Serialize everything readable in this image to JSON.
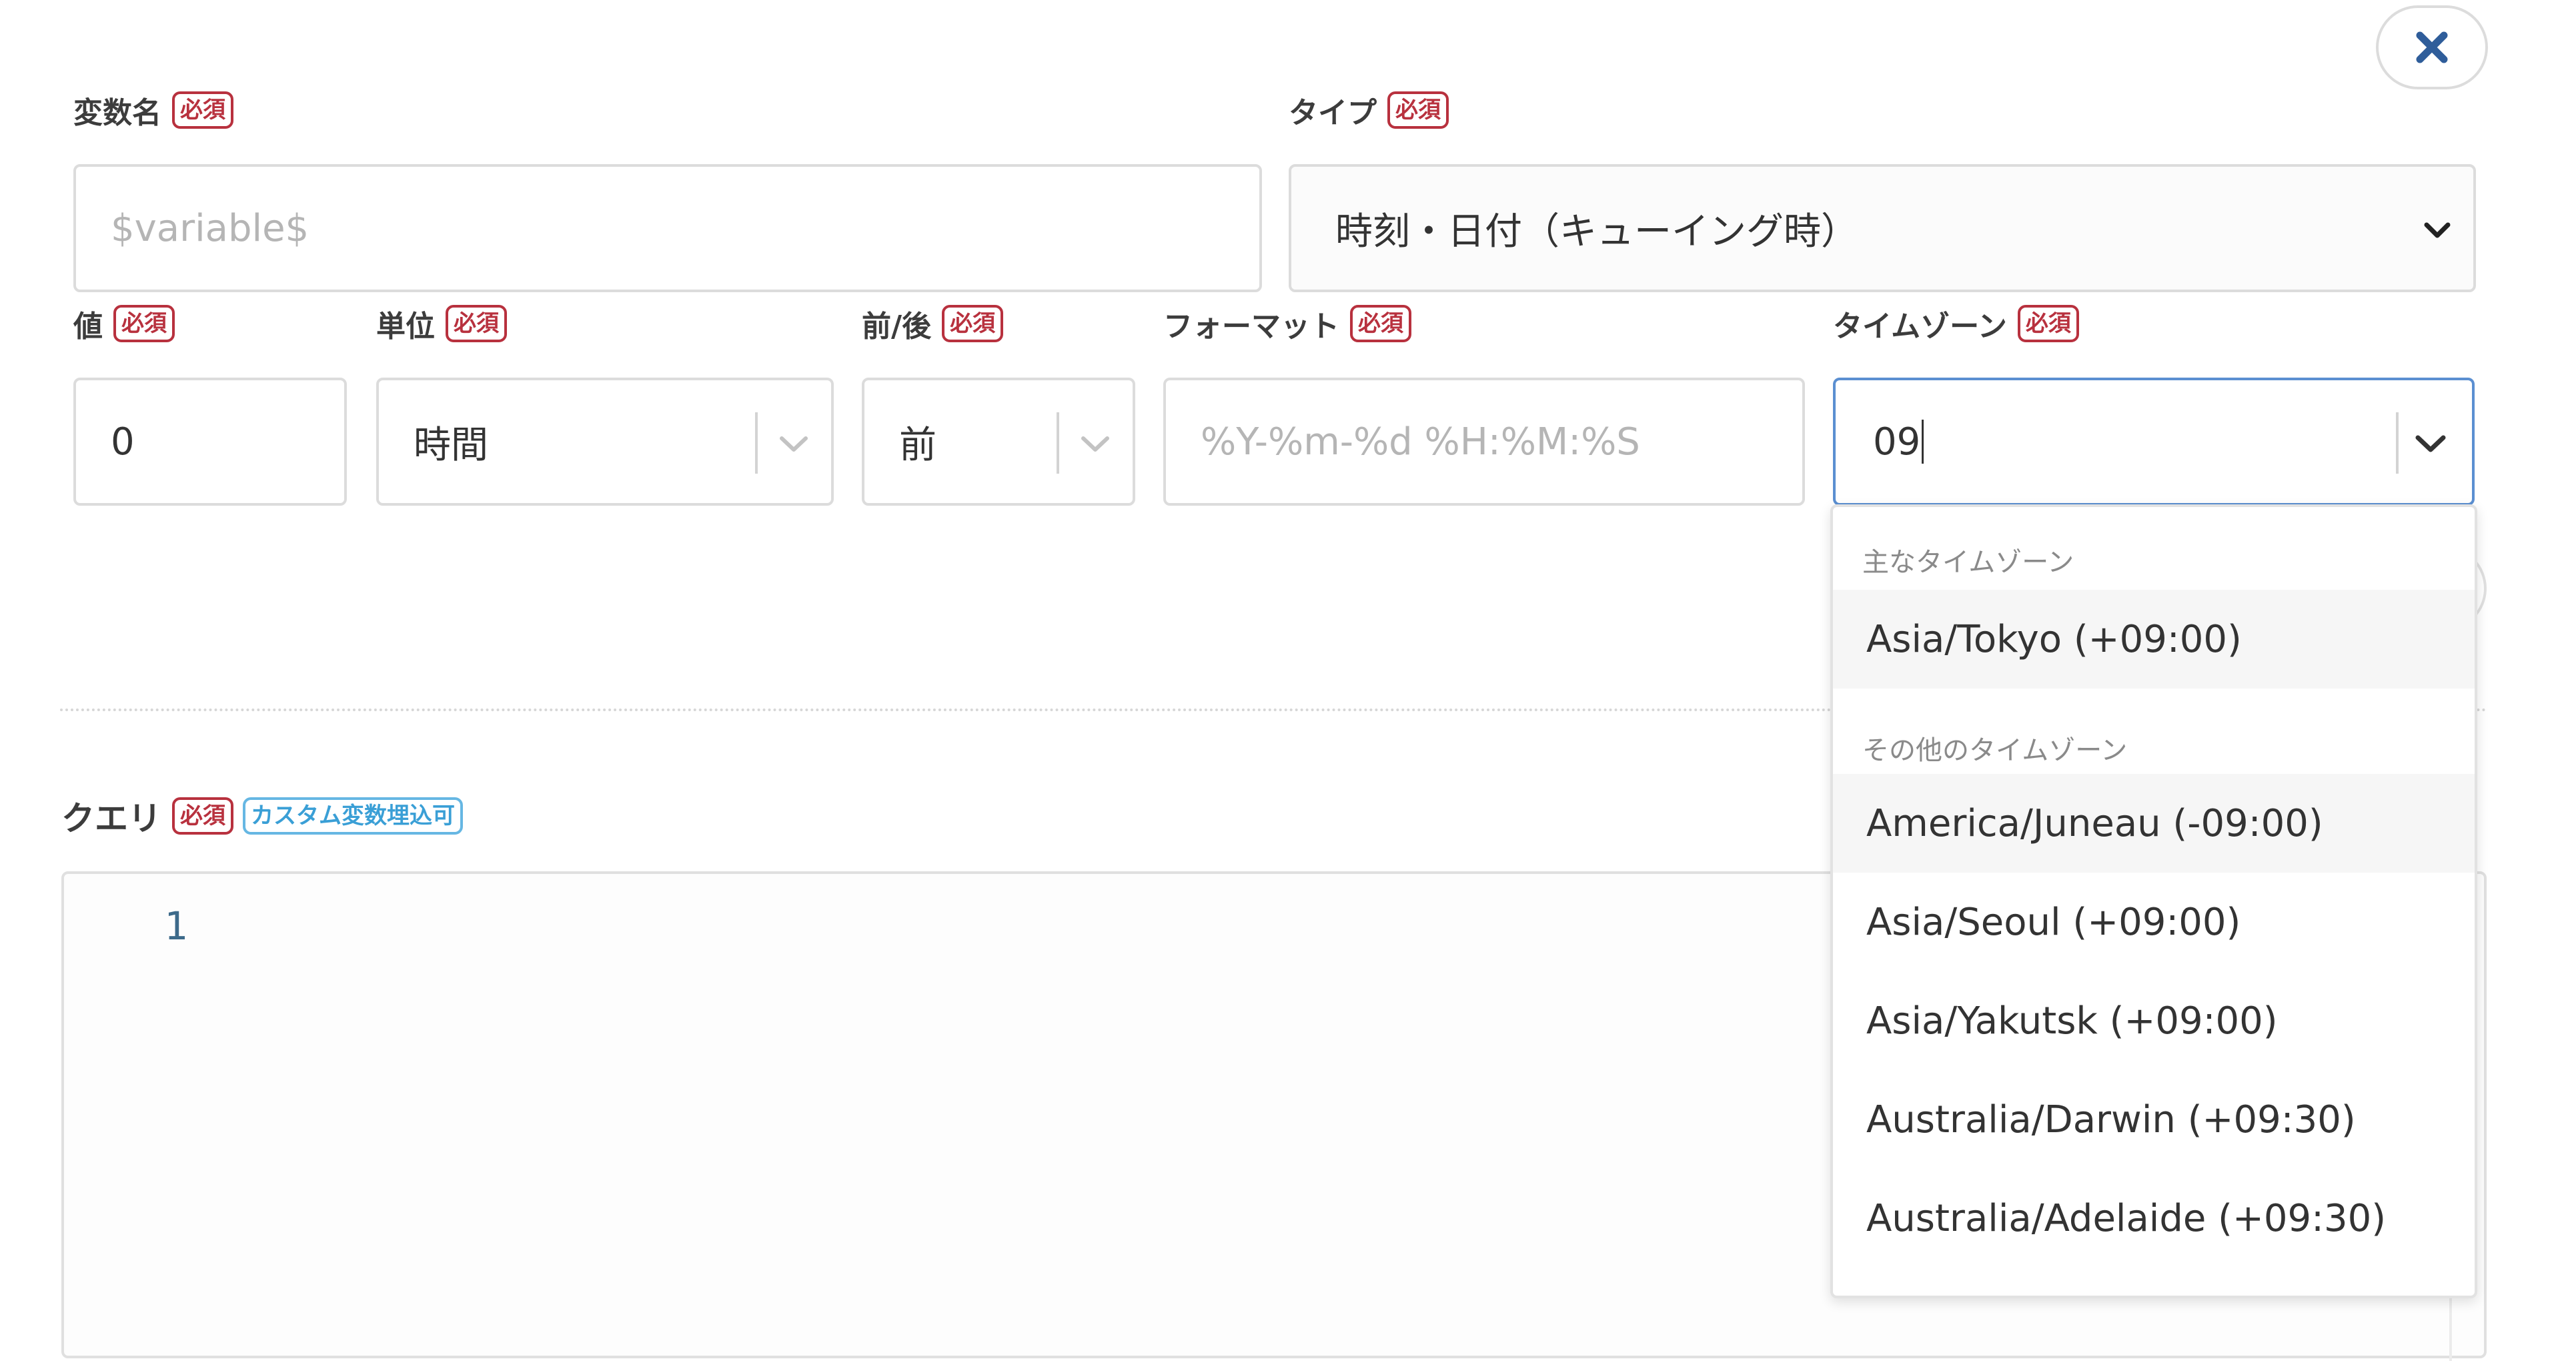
{
  "badges": {
    "required": "必須",
    "custom_var": "カスタム変数埋込可"
  },
  "variable_name": {
    "label": "変数名",
    "placeholder": "$variable$"
  },
  "type": {
    "label": "タイプ",
    "value": "時刻・日付（キューイング時）"
  },
  "value": {
    "label": "値",
    "value": "0"
  },
  "unit": {
    "label": "単位",
    "value": "時間"
  },
  "before_after": {
    "label": "前/後",
    "value": "前"
  },
  "format": {
    "label": "フォーマット",
    "placeholder": "%Y-%m-%d %H:%M:%S"
  },
  "timezone": {
    "label": "タイムゾーン",
    "search_value": "09",
    "groups": [
      {
        "heading": "主なタイムゾーン",
        "options": [
          "Asia/Tokyo (+09:00)"
        ]
      },
      {
        "heading": "その他のタイムゾーン",
        "options": [
          "America/Juneau (-09:00)",
          "Asia/Seoul (+09:00)",
          "Asia/Yakutsk (+09:00)",
          "Australia/Darwin (+09:30)",
          "Australia/Adelaide (+09:30)"
        ]
      }
    ]
  },
  "query": {
    "label": "クエリ",
    "line_number": "1"
  },
  "icons": {
    "close": "close-icon",
    "chevron": "chevron-down-icon"
  },
  "colors": {
    "required_badge": "#b8313e",
    "info_badge": "#3a9fd6",
    "line_number": "#3d6a8a",
    "close_icon": "#2f5d9a"
  }
}
